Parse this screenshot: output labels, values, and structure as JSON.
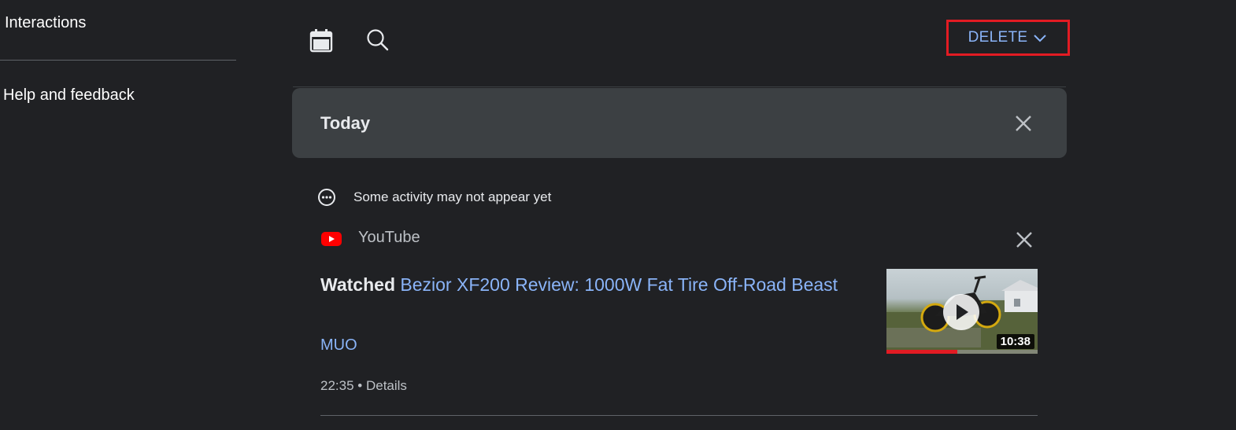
{
  "sidebar": {
    "items": [
      {
        "label": "Interactions"
      },
      {
        "label": "Help and feedback"
      }
    ]
  },
  "toolbar": {
    "calendar_icon": "calendar-icon",
    "search_icon": "search-icon",
    "delete_label": "DELETE",
    "delete_icon": "chevron-down-icon"
  },
  "today": {
    "title": "Today"
  },
  "notice": {
    "text": "Some activity may not appear yet"
  },
  "activity": {
    "source": "YouTube",
    "verb": "Watched",
    "title": "Bezior XF200 Review: 1000W Fat Tire Off-Road Beast",
    "channel": "MUO",
    "time": "22:35",
    "separator": "•",
    "details_label": "Details",
    "thumbnail": {
      "duration": "10:38",
      "watched_fraction": 0.47
    }
  },
  "colors": {
    "background": "#202124",
    "card": "#3c4043",
    "link": "#8ab4f8",
    "highlight": "#e21b23",
    "youtube_red": "#ff0000"
  }
}
